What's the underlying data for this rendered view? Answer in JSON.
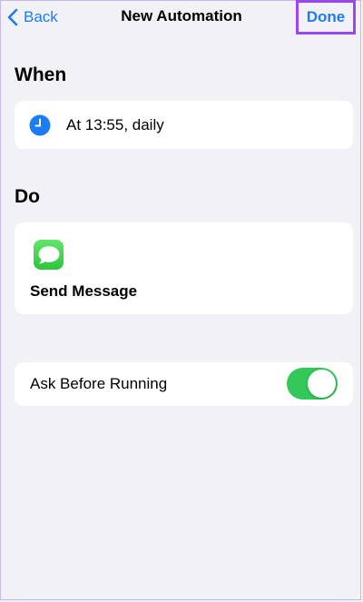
{
  "navbar": {
    "back_label": "Back",
    "title": "New Automation",
    "done_label": "Done"
  },
  "when": {
    "title": "When",
    "trigger": "At 13:55, daily",
    "icon": "clock-icon"
  },
  "do": {
    "title": "Do",
    "action": "Send Message",
    "icon": "messages-icon"
  },
  "ask_before_running": {
    "label": "Ask Before Running",
    "enabled": true
  },
  "colors": {
    "accent": "#1b7cf5",
    "toggle_on": "#34c759",
    "highlight": "#9a47f3",
    "background": "#f2f1f6"
  }
}
